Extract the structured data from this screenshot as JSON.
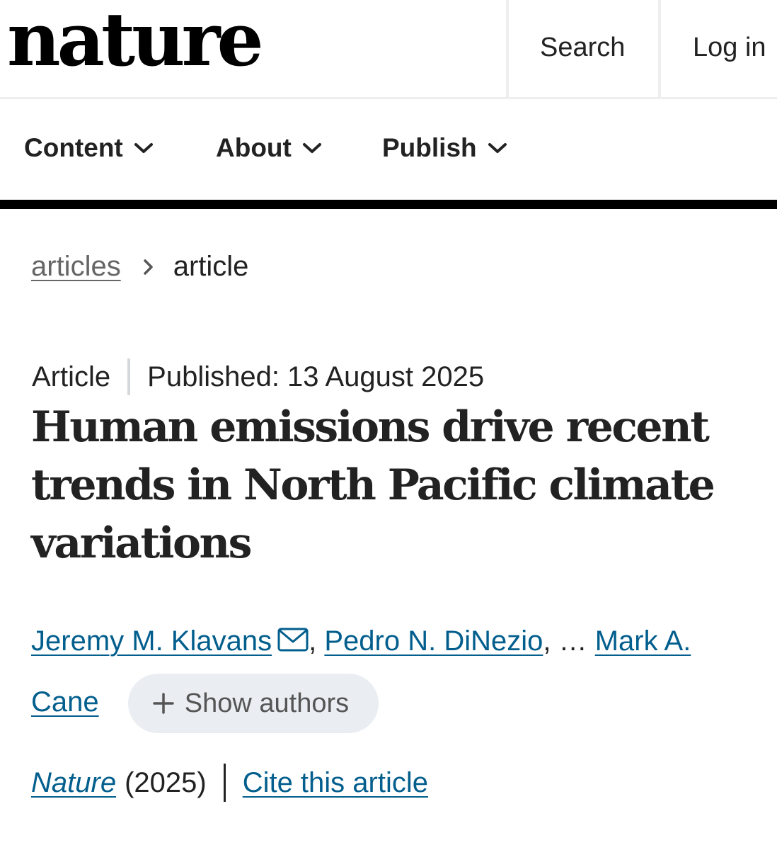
{
  "header": {
    "logo": "nature",
    "search_label": "Search",
    "login_label": "Log in"
  },
  "nav": {
    "items": [
      {
        "label": "Content",
        "icon": "chevron-down-icon"
      },
      {
        "label": "About",
        "icon": "chevron-down-icon"
      },
      {
        "label": "Publish",
        "icon": "chevron-down-icon"
      }
    ]
  },
  "breadcrumb": {
    "items": [
      "articles",
      "article"
    ]
  },
  "article": {
    "type": "Article",
    "published": "Published: 13 August 2025",
    "title": "Human emissions drive recent trends in North Pacific climate variations",
    "authors": {
      "first": "Jeremy M. Klavans",
      "second": "Pedro N. DiNezio",
      "separator": ",",
      "ellipsis": ", … ",
      "last": "Mark A. Cane",
      "show_authors_label": "Show authors"
    },
    "journal": "Nature",
    "year": "(2025)",
    "cite_label": "Cite this article"
  },
  "colors": {
    "link": "#025e8d",
    "text": "#222222",
    "rule": "#000000",
    "pill": "#eaeef2"
  }
}
